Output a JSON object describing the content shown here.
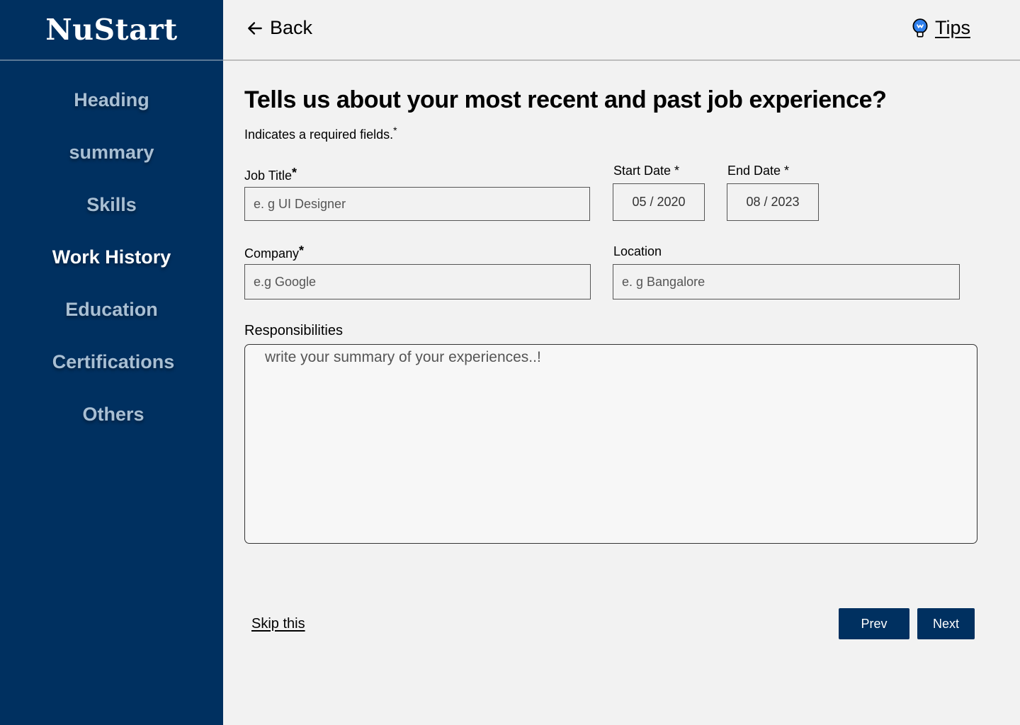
{
  "brand": {
    "name": "NuStart"
  },
  "sidebar": {
    "items": [
      {
        "label": "Heading",
        "active": false
      },
      {
        "label": "summary",
        "active": false
      },
      {
        "label": "Skills",
        "active": false
      },
      {
        "label": "Work History",
        "active": true
      },
      {
        "label": "Education",
        "active": false
      },
      {
        "label": "Certifications",
        "active": false
      },
      {
        "label": "Others",
        "active": false
      }
    ]
  },
  "topbar": {
    "back_label": "Back",
    "tips_label": "Tips"
  },
  "main": {
    "title": "Tells us about your most recent and past job experience?",
    "required_note": "Indicates a required fields.",
    "required_mark": "*"
  },
  "form": {
    "job_title": {
      "label": "Job Title",
      "required": "*",
      "placeholder": "e. g UI Designer"
    },
    "start_date": {
      "label": "Start Date *",
      "value": "05 / 2020"
    },
    "end_date": {
      "label": "End Date *",
      "value": "08 / 2023"
    },
    "company": {
      "label": "Company",
      "required": "*",
      "placeholder": "e.g Google"
    },
    "location": {
      "label": "Location",
      "placeholder": "e. g Bangalore"
    },
    "responsibilities": {
      "label": "Responsibilities",
      "placeholder": "write your summary of your experiences..!"
    }
  },
  "footer": {
    "skip_label": "Skip this",
    "prev_label": "Prev",
    "next_label": "Next"
  },
  "colors": {
    "sidebar_bg": "#003060",
    "page_bg": "#f2f2f2",
    "button_bg": "#003060",
    "tips_icon": "#2f80ed"
  }
}
